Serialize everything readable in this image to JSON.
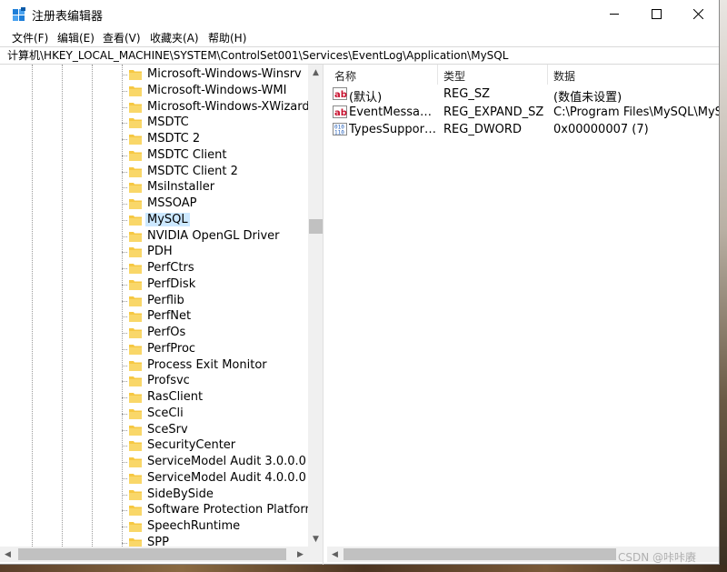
{
  "window": {
    "title": "注册表编辑器",
    "controls": {
      "minimize": "—",
      "maximize": "☐",
      "close": "✕"
    }
  },
  "menu": [
    "文件(F)",
    "编辑(E)",
    "查看(V)",
    "收藏夹(A)",
    "帮助(H)"
  ],
  "address": "计算机\\HKEY_LOCAL_MACHINE\\SYSTEM\\ControlSet001\\Services\\EventLog\\Application\\MySQL",
  "tree": {
    "items": [
      "Microsoft-Windows-Winsrv",
      "Microsoft-Windows-WMI",
      "Microsoft-Windows-XWizards",
      "MSDTC",
      "MSDTC 2",
      "MSDTC Client",
      "MSDTC Client 2",
      "MsiInstaller",
      "MSSOAP",
      "MySQL",
      "NVIDIA OpenGL Driver",
      "PDH",
      "PerfCtrs",
      "PerfDisk",
      "Perflib",
      "PerfNet",
      "PerfOs",
      "PerfProc",
      "Process Exit Monitor",
      "Profsvc",
      "RasClient",
      "SceCli",
      "SceSrv",
      "SecurityCenter",
      "ServiceModel Audit 3.0.0.0",
      "ServiceModel Audit 4.0.0.0",
      "SideBySide",
      "Software Protection Platform Service",
      "SpeechRuntime",
      "SPP"
    ],
    "selected": "MySQL"
  },
  "list": {
    "columns": [
      "名称",
      "类型",
      "数据"
    ],
    "rows": [
      {
        "icon": "string-value-icon",
        "name": "(默认)",
        "type": "REG_SZ",
        "data": "(数值未设置)"
      },
      {
        "icon": "string-value-icon",
        "name": "EventMessageFile",
        "type": "REG_EXPAND_SZ",
        "data": "C:\\Program Files\\MySQL\\MySQL Server\\lib\\plugin\\component_reference_cache.dll"
      },
      {
        "icon": "binary-value-icon",
        "name": "TypesSupported",
        "type": "REG_DWORD",
        "data": "0x00000007 (7)"
      }
    ]
  },
  "watermark": "CSDN @咔咔赓",
  "colors": {
    "selection": "#cce8ff",
    "folder": "#f6c843",
    "accent": "#0078d7"
  }
}
